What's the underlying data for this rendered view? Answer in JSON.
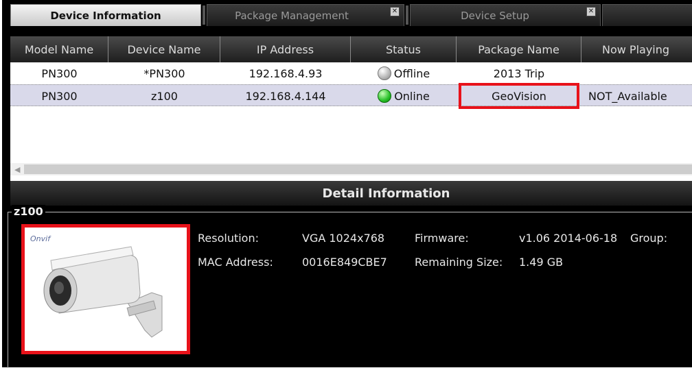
{
  "tabs": [
    {
      "label": "Device Information",
      "active": true
    },
    {
      "label": "Package Management",
      "active": false
    },
    {
      "label": "Device Setup",
      "active": false
    }
  ],
  "table": {
    "columns": [
      "Model Name",
      "Device Name",
      "IP Address",
      "Status",
      "Package Name",
      "Now Playing"
    ],
    "rows": [
      {
        "model": "PN300",
        "device": "*PN300",
        "ip": "192.168.4.93",
        "status": "Offline",
        "package": "2013 Trip",
        "now_playing": ""
      },
      {
        "model": "PN300",
        "device": "z100",
        "ip": "192.168.4.144",
        "status": "Online",
        "package": "GeoVision",
        "now_playing": "NOT_Available"
      }
    ]
  },
  "detail": {
    "header": "Detail Information",
    "device_name": "z100",
    "logo_text": "Onvif",
    "resolution_label": "Resolution:",
    "resolution_value": "VGA 1024x768",
    "firmware_label": "Firmware:",
    "firmware_value": "v1.06 2014-06-18",
    "group_label": "Group:",
    "mac_label": "MAC Address:",
    "mac_value": "0016E849CBE7",
    "remaining_label": "Remaining Size:",
    "remaining_value": "1.49 GB"
  },
  "colors": {
    "highlight": "#e8121a",
    "online": "#28c028",
    "offline": "#a8a8a8",
    "selected_row": "#d9d9ea"
  }
}
